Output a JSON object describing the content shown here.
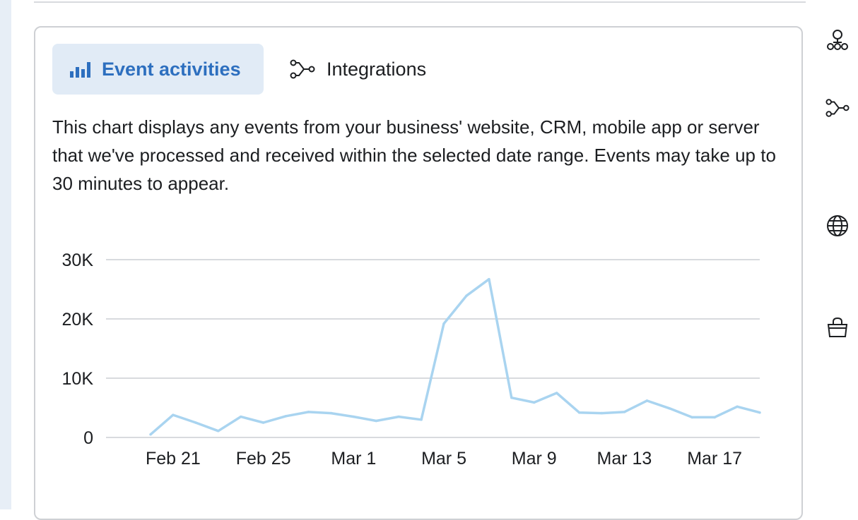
{
  "tabs": [
    {
      "label": "Event activities",
      "icon": "bar-chart-icon",
      "active": true
    },
    {
      "label": "Integrations",
      "icon": "integrations-icon",
      "active": false
    }
  ],
  "description": "This chart displays any events from your business' website, CRM, mobile app or server that we've processed and received within the selected date range. Events may take up to 30 minutes to appear.",
  "side_icons": [
    "network-icon",
    "integrations-icon",
    "globe-icon",
    "shopping-bag-icon"
  ],
  "colors": {
    "accent": "#2d6fbf",
    "tab_bg": "#e1ebf6",
    "line": "#a9d4f0",
    "grid": "#d8dade"
  },
  "chart_data": {
    "type": "line",
    "title": "",
    "xlabel": "",
    "ylabel": "",
    "x": [
      "Feb 20",
      "Feb 21",
      "Feb 22",
      "Feb 23",
      "Feb 24",
      "Feb 25",
      "Feb 26",
      "Feb 27",
      "Feb 28",
      "Mar 1",
      "Mar 2",
      "Mar 3",
      "Mar 4",
      "Mar 5",
      "Mar 6",
      "Mar 7",
      "Mar 8",
      "Mar 9",
      "Mar 10",
      "Mar 11",
      "Mar 12",
      "Mar 13",
      "Mar 14",
      "Mar 15",
      "Mar 16",
      "Mar 17",
      "Mar 18",
      "Mar 19"
    ],
    "x_tick_labels": [
      "Feb 21",
      "Feb 25",
      "Mar 1",
      "Mar 5",
      "Mar 9",
      "Mar 13",
      "Mar 17"
    ],
    "series": [
      {
        "values": [
          500,
          3800,
          2500,
          1100,
          3500,
          2500,
          3600,
          4300,
          4100,
          3500,
          2800,
          3500,
          3000,
          19200,
          23900,
          26700,
          6700,
          5900,
          7500,
          4200,
          4100,
          4300,
          6200,
          4900,
          3400,
          3400,
          5200,
          4200
        ]
      }
    ],
    "y_ticks": [
      0,
      10000,
      20000,
      30000
    ],
    "y_tick_labels": [
      "0",
      "10K",
      "20K",
      "30K"
    ],
    "ylim": [
      0,
      30000
    ],
    "grid": true
  }
}
